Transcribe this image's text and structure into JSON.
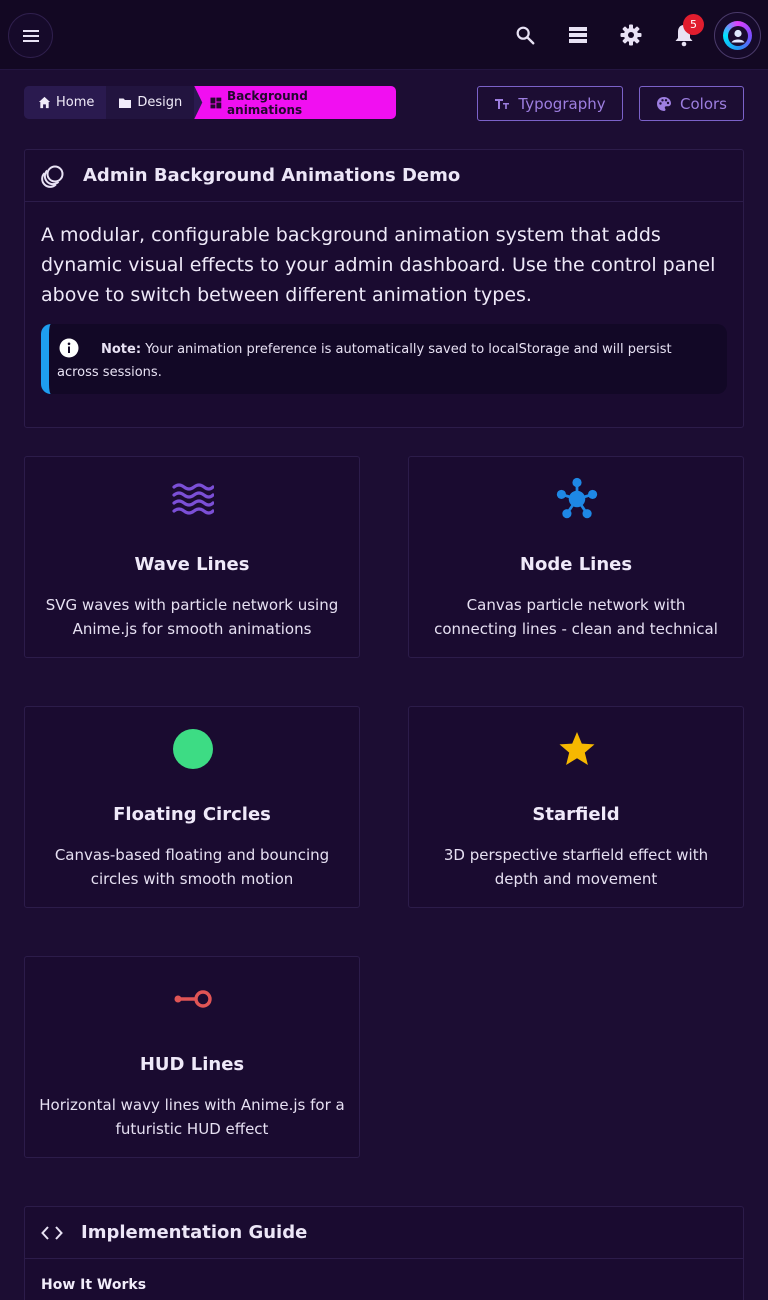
{
  "header": {
    "notification_count": "5"
  },
  "breadcrumb": {
    "home": "Home",
    "design": "Design",
    "current": "Background animations"
  },
  "buttons": {
    "typography": "Typography",
    "colors": "Colors"
  },
  "intro": {
    "title": "Admin Background Animations Demo",
    "description": "A modular, configurable background animation system that adds dynamic visual effects to your admin dashboard. Use the control panel above to switch between different animation types.",
    "note_label": "Note:",
    "note_text": "Your animation preference is automatically saved to localStorage and will persist across sessions."
  },
  "animations": [
    {
      "title": "Wave Lines",
      "description": "SVG waves with particle network using Anime.js for smooth animations",
      "icon": "waves-icon",
      "color": "#7b4fd6"
    },
    {
      "title": "Node Lines",
      "description": "Canvas particle network with connecting lines - clean and technical",
      "icon": "hub-icon",
      "color": "#1e88e5"
    },
    {
      "title": "Floating Circles",
      "description": "Canvas-based floating and bouncing circles with smooth motion",
      "icon": "circle-icon",
      "color": "#3ddc84"
    },
    {
      "title": "Starfield",
      "description": "3D perspective starfield effect with depth and movement",
      "icon": "star-icon",
      "color": "#f6b800"
    },
    {
      "title": "HUD Lines",
      "description": "Horizontal wavy lines with Anime.js for a futuristic HUD effect",
      "icon": "hud-line-icon",
      "color": "#e05555"
    }
  ],
  "guide": {
    "title": "Implementation Guide",
    "subtitle": "How It Works"
  },
  "colors": {
    "background": "#1c0d33",
    "header": "#130823",
    "accent_pink": "#f10ff1",
    "accent_purple": "#7b62c9",
    "note_border": "#1e9ef0",
    "badge": "#e11d2e"
  }
}
